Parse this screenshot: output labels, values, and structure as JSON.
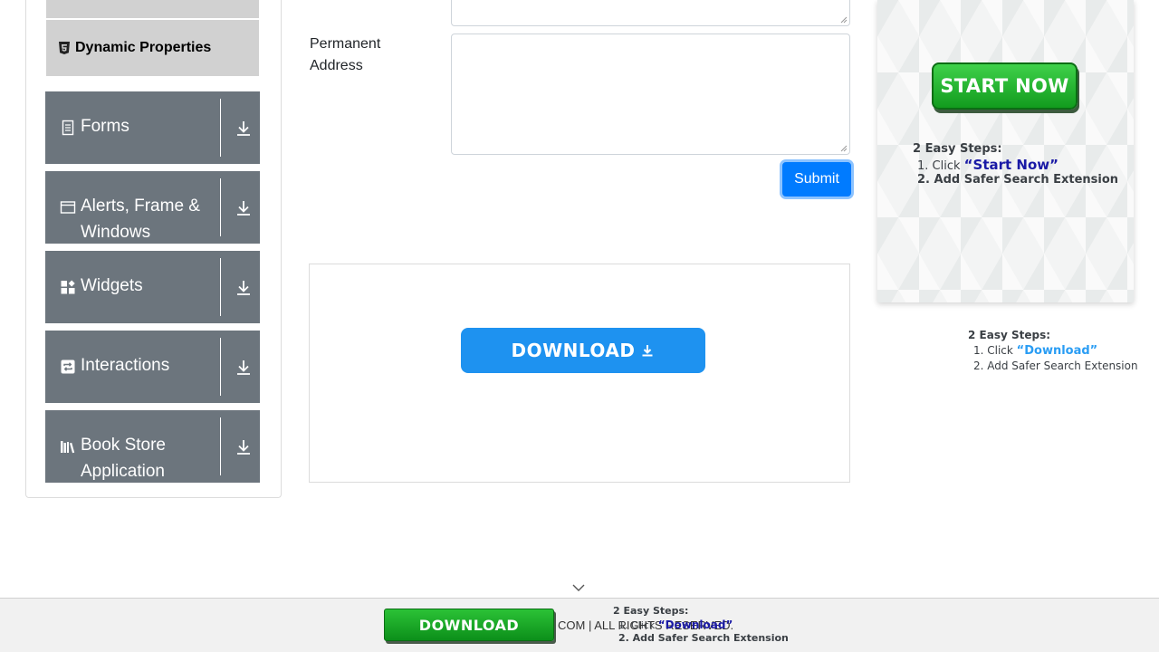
{
  "sidebar": {
    "dynamic_properties": "Dynamic Properties",
    "categories": [
      {
        "label": "Forms"
      },
      {
        "label": "Alerts, Frame & Windows"
      },
      {
        "label": "Widgets"
      },
      {
        "label": "Interactions"
      },
      {
        "label": "Book Store Application"
      }
    ]
  },
  "form": {
    "permanent_address_label": "Permanent Address",
    "submit_label": "Submit"
  },
  "ad_center": {
    "download_label": "DOWNLOAD"
  },
  "ad_right": {
    "start_now_label": "START NOW",
    "steps_title": "2 Easy Steps:",
    "step1_prefix": "1. Click ",
    "step1_highlight": "“Start Now”",
    "step2": "2. Add Safer Search Extension"
  },
  "ad_right_lower": {
    "steps_title": "2 Easy Steps:",
    "step1_prefix": "1. Click ",
    "step1_highlight": "“Download”",
    "step2": "2. Add Safer Search Extension"
  },
  "footer": {
    "copyright_fragment": "COM | ALL RIGHTS RESERVED.",
    "download_label": "DOWNLOAD",
    "steps_title": "2 Easy Steps:",
    "step1_prefix": "1. Click ",
    "step1_highlight": "“Download”",
    "step2": "2. Add Safer Search Extension"
  },
  "colors": {
    "sidebar_category_bg": "#6c757d",
    "submit_bg": "#007bff",
    "download_blue": "#1e92f0",
    "ad_green": "#129b1e"
  }
}
